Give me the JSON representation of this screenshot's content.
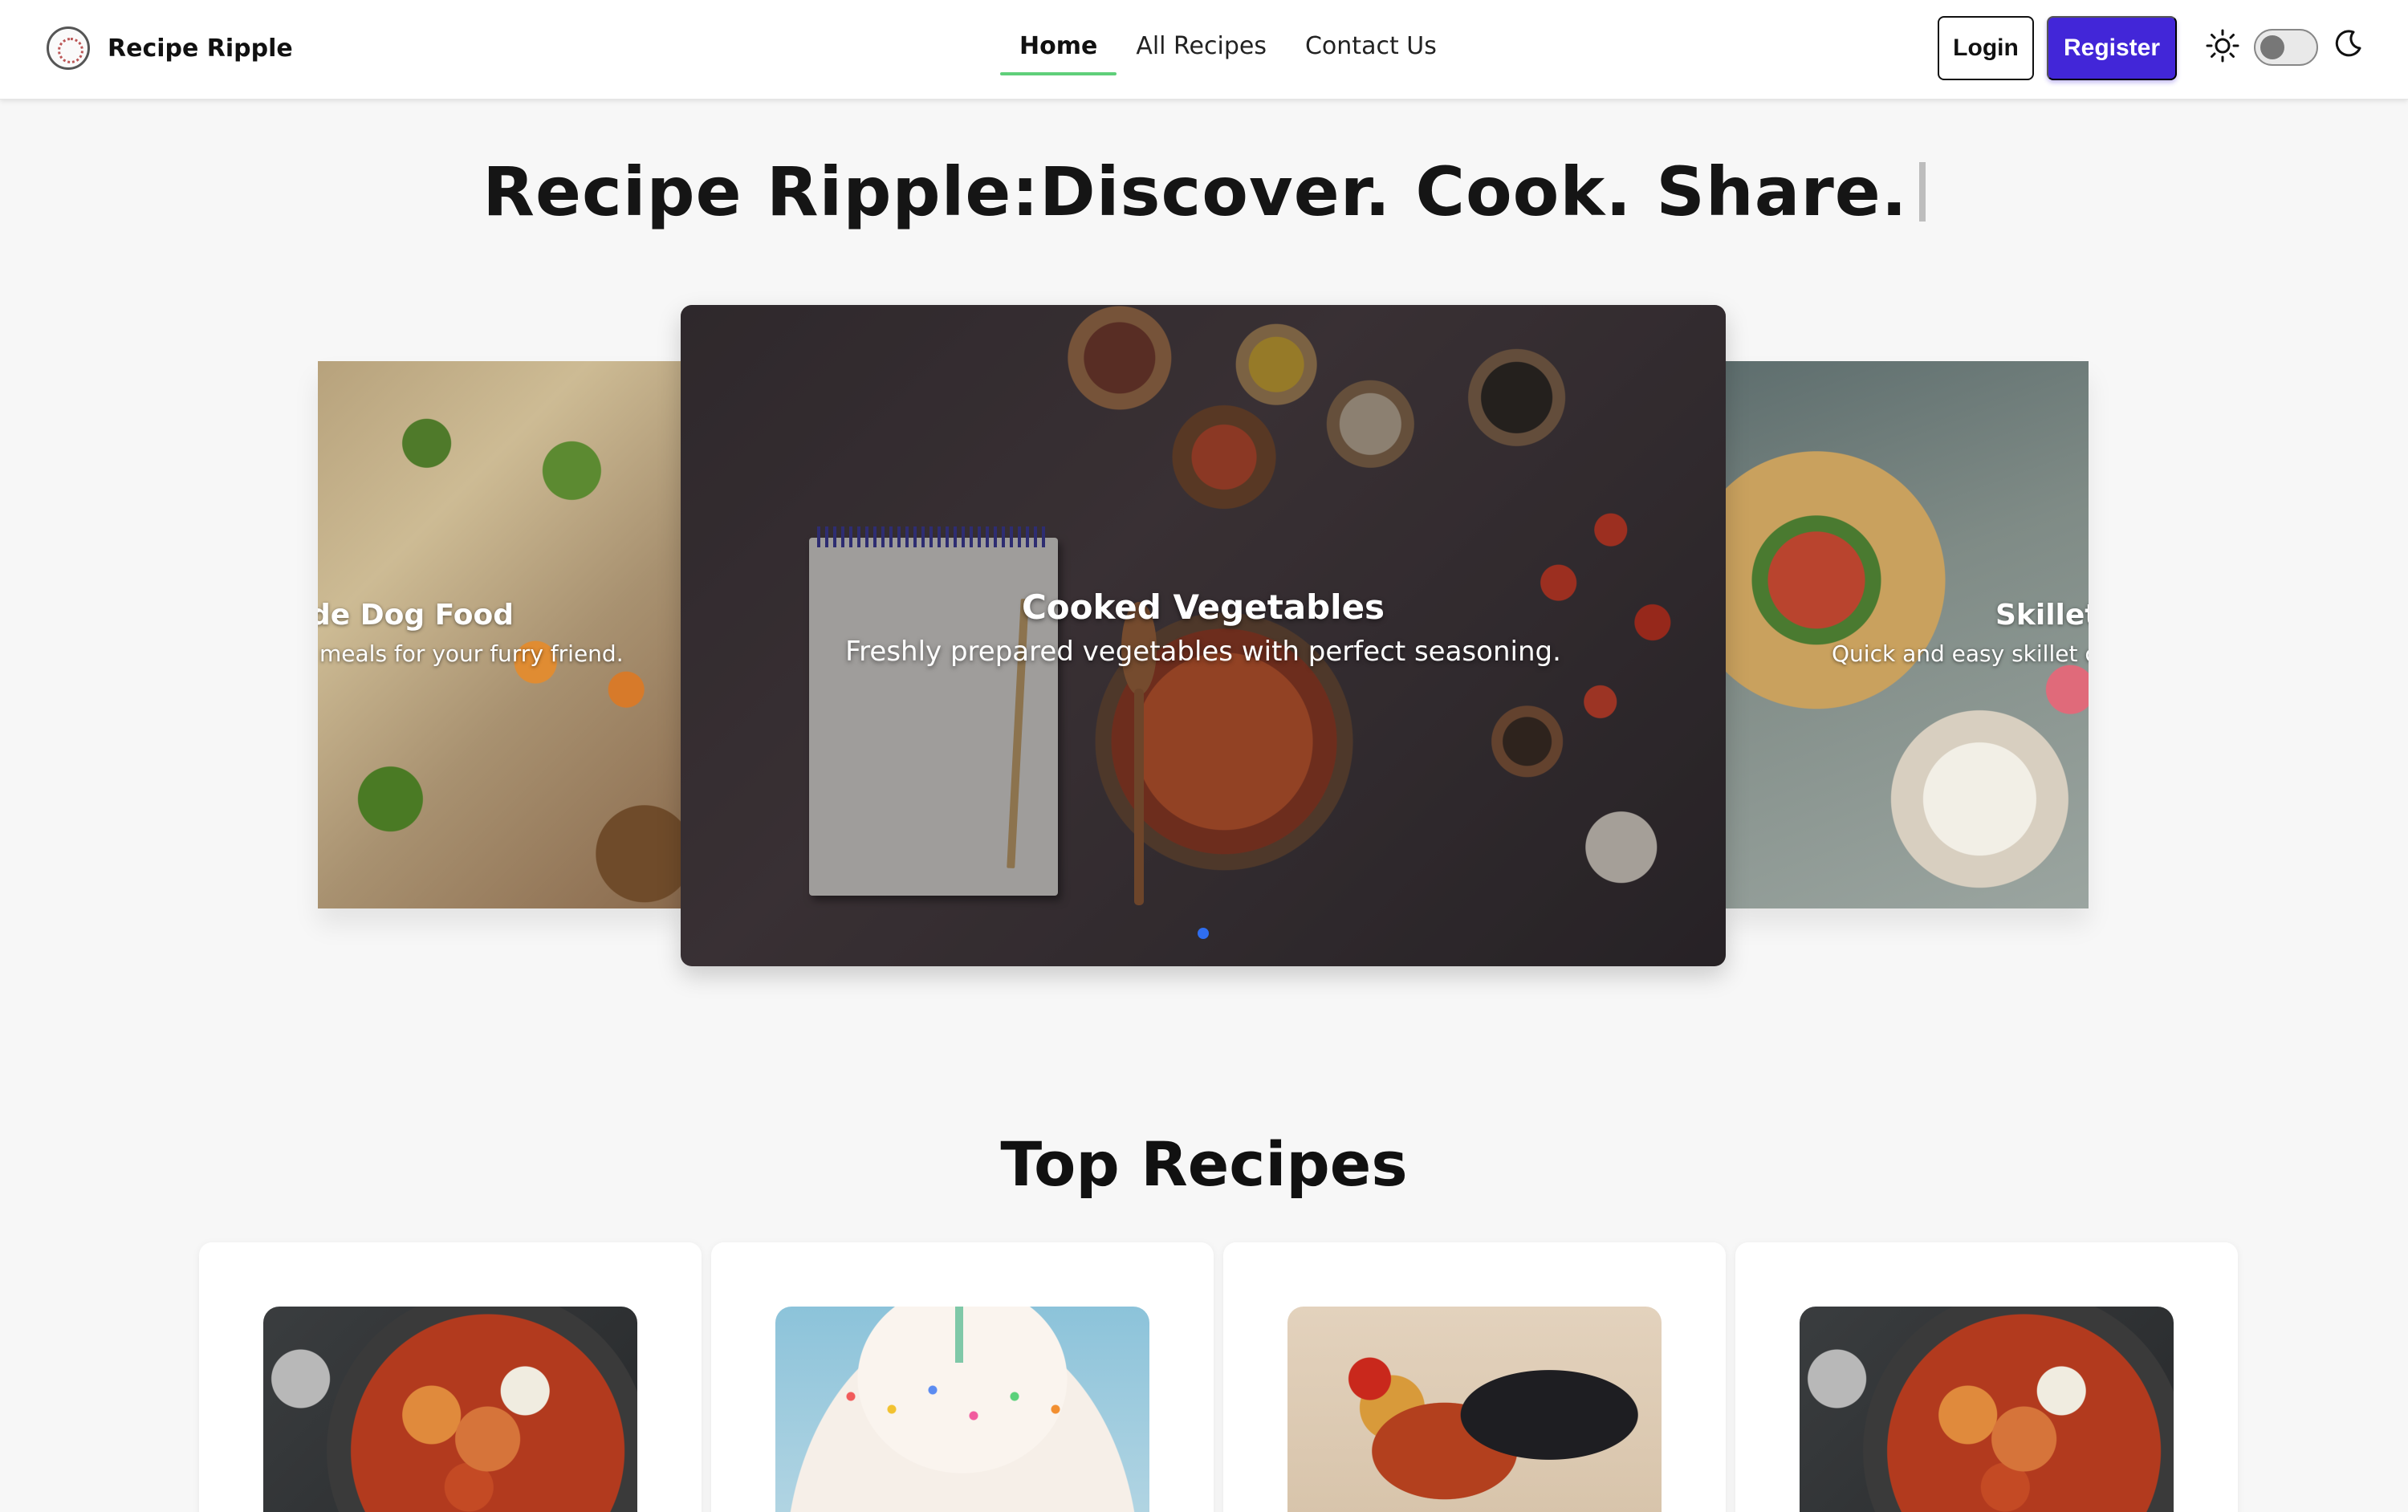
{
  "navbar": {
    "brand": "Recipe Ripple",
    "links": [
      {
        "label": "Home",
        "active": true
      },
      {
        "label": "All Recipes",
        "active": false
      },
      {
        "label": "Contact Us",
        "active": false
      }
    ],
    "login_label": "Login",
    "register_label": "Register",
    "register_color": "#4226d8",
    "theme_toggle": {
      "state": "light",
      "icons": [
        "sun-icon",
        "moon-icon"
      ]
    }
  },
  "hero": {
    "title": "Recipe Ripple:Discover. Cook. Share."
  },
  "carousel": {
    "active_index": 0,
    "dot_color": "#2f6ef0",
    "main": {
      "title": "Cooked Vegetables",
      "text": "Freshly prepared vegetables with perfect seasoning."
    },
    "prev": {
      "title": "de Dog Food",
      "text": "meals for your furry friend."
    },
    "next": {
      "title": "Skillet",
      "text": "Quick and easy skillet chil"
    }
  },
  "top_recipes": {
    "title": "Top Recipes",
    "cards": [
      {
        "image": "gnocchi-skillet"
      },
      {
        "image": "sprinkle-cake"
      },
      {
        "image": "rooster"
      },
      {
        "image": "gnocchi-skillet"
      }
    ]
  }
}
